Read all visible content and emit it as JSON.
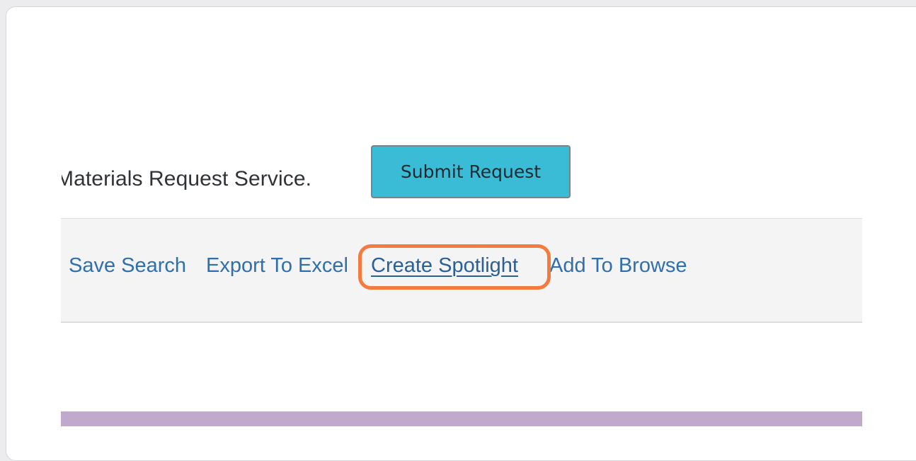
{
  "intro": {
    "text": "Materials Request Service."
  },
  "submit_button": {
    "label": "Submit Request",
    "color": "#3bbcd6"
  },
  "toolbar": {
    "links": [
      {
        "label": "Save Search"
      },
      {
        "label": "Export To Excel"
      },
      {
        "label": "Create Spotlight",
        "highlighted": true
      },
      {
        "label": "Add To Browse"
      }
    ],
    "highlight_color": "#f47a3d",
    "link_color": "#2f6fae"
  },
  "footer_bar": {
    "color": "#c0a9cd"
  }
}
